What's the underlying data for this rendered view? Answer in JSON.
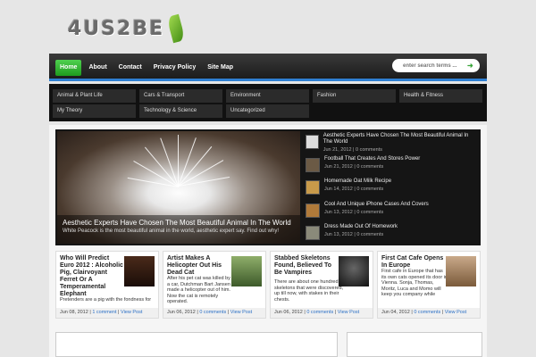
{
  "site": {
    "logo": "4US2BE"
  },
  "nav": {
    "items": [
      "Home",
      "About",
      "Contact",
      "Privacy Policy",
      "Site Map"
    ],
    "search_placeholder": "enter search terms ..."
  },
  "categories": [
    "Animal & Plant Life",
    "Cars & Transport",
    "Environment",
    "Fashion",
    "Health & Fitness",
    "My Theory",
    "Technology & Science",
    "Uncategorized"
  ],
  "featured": {
    "title": "Aesthetic Experts Have Chosen The Most Beautiful Animal In The World",
    "excerpt": "White Peacock is the most beautiful animal in the world, aesthetic expert say. Find out why!",
    "list": [
      {
        "title": "Aesthetic Experts Have Chosen The Most Beautiful Animal In The World",
        "date": "Jun 21, 2012",
        "comments": "0 comments"
      },
      {
        "title": "Football That Creates And Stores Power",
        "date": "Jun 21, 2012",
        "comments": "0 comments"
      },
      {
        "title": "Homemade Oat Milk Recipe",
        "date": "Jun 14, 2012",
        "comments": "0 comments"
      },
      {
        "title": "Cool And Unique iPhone Cases And Covers",
        "date": "Jun 13, 2012",
        "comments": "0 comments"
      },
      {
        "title": "Dress Made Out Of Homework",
        "date": "Jun 13, 2012",
        "comments": "0 comments"
      }
    ]
  },
  "cards": [
    {
      "title": "Who Will Predict Euro 2012 : Alcoholic Pig, Clairvoyant Ferret Or A Temperamental Elephant",
      "excerpt": "Pretenders are a pig with the fondness for",
      "date": "Jun 08, 2012",
      "comments": "1 comment",
      "view": "View Post"
    },
    {
      "title": "Artist Makes A Helicopter Out His Dead Cat",
      "excerpt": "After his pet cat was killed by a car, Dutchman Bart Jansen made a helicopter out of him. Now the cat is remotely operated.",
      "date": "Jun 06, 2012",
      "comments": "0 comments",
      "view": "View Post"
    },
    {
      "title": "Stabbed Skeletons Found, Believed To Be Vampires",
      "excerpt": "There are about one hundred skeletons that were discovered, up till now, with stakes in their chests.",
      "date": "Jun 06, 2012",
      "comments": "0 comments",
      "view": "View Post"
    },
    {
      "title": "First Cat Cafe Opens In Europe",
      "excerpt": "First cafe in Europe that has its own cats opened its door in Vienna. Sonja, Thomas, Moritz, Luca and Momo will keep you company while",
      "date": "Jun 04, 2012",
      "comments": "0 comments",
      "view": "View Post"
    }
  ],
  "colors": {
    "accent": "#2f7fd1",
    "active_nav": "#2db82d",
    "link": "#2a6fc5"
  }
}
